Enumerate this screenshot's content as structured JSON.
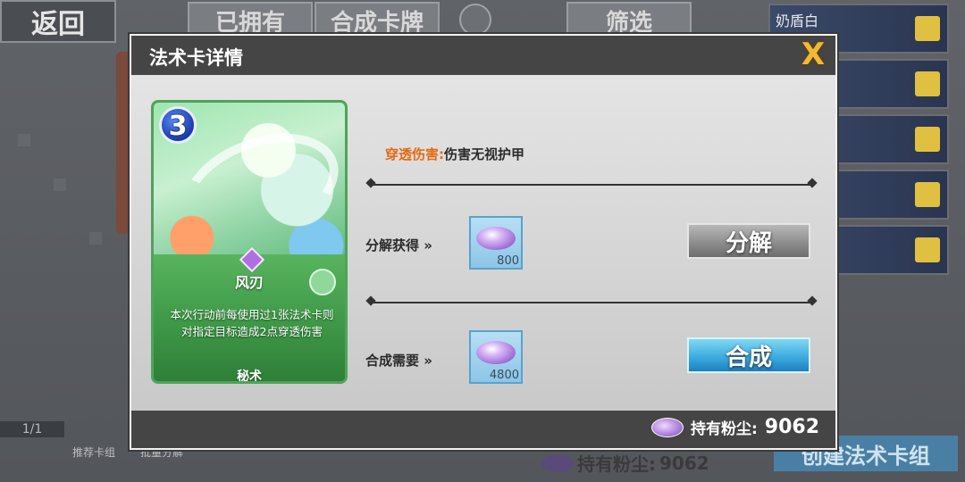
{
  "background": {
    "back_label": "返回",
    "owned_label": "已拥有",
    "synth_tab_label": "合成卡牌",
    "filter_label": "筛选",
    "deck_name": "奶盾白",
    "page_indicator": "1/1",
    "recommended_label": "推荐卡组",
    "batch_decompose_label": "批量分解",
    "dust_label": "持有粉尘:",
    "dust_value": "9062",
    "create_deck_label": "创建法术卡组"
  },
  "dialog": {
    "title": "法术卡详情",
    "close_icon": "X",
    "card": {
      "cost": "3",
      "name": "风刃",
      "description": "本次行动前每使用过1张法术卡则对指定目标造成2点穿透伤害",
      "type": "秘术"
    },
    "effect": {
      "keyword": "穿透伤害:",
      "text": "伤害无视护甲"
    },
    "decompose": {
      "label": "分解获得",
      "arrow": "»",
      "amount": "800",
      "button_label": "分解"
    },
    "synthesize": {
      "label": "合成需要",
      "arrow": "»",
      "amount": "4800",
      "button_label": "合成"
    },
    "footer": {
      "dust_label": "持有粉尘:",
      "dust_value": "9062"
    }
  },
  "colors": {
    "keyword": "#e36b12",
    "card_border": "#4fa35a",
    "synth_button": "#38a8dc",
    "decompose_button": "#8a8a8a"
  }
}
